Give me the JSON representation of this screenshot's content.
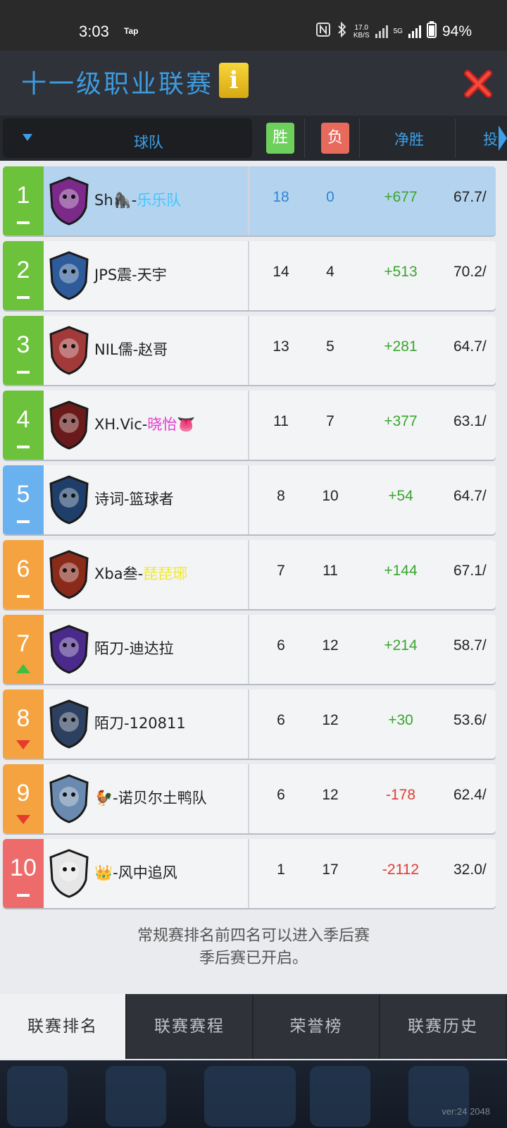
{
  "status_bar": {
    "time": "3:03",
    "tap_label": "Tap",
    "net_speed_value": "17.0",
    "net_speed_unit": "KB/S",
    "network_type": "5G",
    "battery": "94%"
  },
  "header": {
    "title": "十一级职业联赛",
    "info_label": "i"
  },
  "columns": {
    "team": "球队",
    "win": "胜",
    "loss": "负",
    "net": "净胜",
    "more": "投"
  },
  "rows": [
    {
      "rank": "1",
      "team": "Sh🦍-",
      "team_hl": "乐乐队",
      "hl_color": "#3fc7ff",
      "w": "18",
      "l": "0",
      "net": "+677",
      "pct": "67.7/",
      "trend": "flat",
      "rank_color": "#6cc23a"
    },
    {
      "rank": "2",
      "team": "JPS震-天宇",
      "team_hl": "",
      "hl_color": "",
      "w": "14",
      "l": "4",
      "net": "+513",
      "pct": "70.2/",
      "trend": "flat",
      "rank_color": "#6cc23a"
    },
    {
      "rank": "3",
      "team": "NIL儒-赵哥",
      "team_hl": "",
      "hl_color": "",
      "w": "13",
      "l": "5",
      "net": "+281",
      "pct": "64.7/",
      "trend": "flat",
      "rank_color": "#6cc23a"
    },
    {
      "rank": "4",
      "team": "XH.Vic-",
      "team_hl": "晓怡👅",
      "hl_color": "#e43ad0",
      "w": "11",
      "l": "7",
      "net": "+377",
      "pct": "63.1/",
      "trend": "flat",
      "rank_color": "#6cc23a"
    },
    {
      "rank": "5",
      "team": "诗词-篮球者",
      "team_hl": "",
      "hl_color": "",
      "w": "8",
      "l": "10",
      "net": "+54",
      "pct": "64.7/",
      "trend": "flat",
      "rank_color": "#6ab2ef"
    },
    {
      "rank": "6",
      "team": "Xba叁-",
      "team_hl": "琵琵琊",
      "hl_color": "#f2e92c",
      "w": "7",
      "l": "11",
      "net": "+144",
      "pct": "67.1/",
      "trend": "flat",
      "rank_color": "#f5a340"
    },
    {
      "rank": "7",
      "team": "陌刀-迪达拉",
      "team_hl": "",
      "hl_color": "",
      "w": "6",
      "l": "12",
      "net": "+214",
      "pct": "58.7/",
      "trend": "up",
      "rank_color": "#f5a340"
    },
    {
      "rank": "8",
      "team": "陌刀-120811",
      "team_hl": "",
      "hl_color": "",
      "w": "6",
      "l": "12",
      "net": "+30",
      "pct": "53.6/",
      "trend": "down",
      "rank_color": "#f5a340"
    },
    {
      "rank": "9",
      "team": "🐓-诺贝尔土鸭队",
      "team_hl": "",
      "hl_color": "",
      "w": "6",
      "l": "12",
      "net": "-178",
      "pct": "62.4/",
      "trend": "down",
      "rank_color": "#f5a340"
    },
    {
      "rank": "10",
      "team": "👑-风中追风",
      "team_hl": "",
      "hl_color": "",
      "w": "1",
      "l": "17",
      "net": "-2112",
      "pct": "32.0/",
      "trend": "flat",
      "rank_color": "#ee6b6b"
    }
  ],
  "note": {
    "line1": "常规赛排名前四名可以进入季后赛",
    "line2": "季后赛已开启。"
  },
  "tabs": [
    {
      "label": "联赛排名",
      "active": true
    },
    {
      "label": "联赛赛程",
      "active": false
    },
    {
      "label": "荣誉榜",
      "active": false
    },
    {
      "label": "联赛历史",
      "active": false
    }
  ],
  "version": "ver:24  2048",
  "colors": {
    "positive": "#3aa52f",
    "negative": "#e03c32",
    "accent": "#3d9be0"
  }
}
